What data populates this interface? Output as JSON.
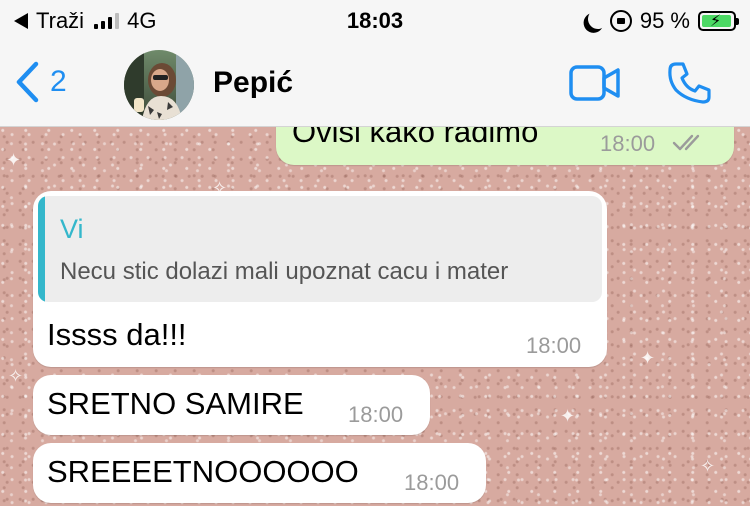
{
  "status_bar": {
    "carrier": "Traži",
    "network": "4G",
    "time": "18:03",
    "battery_percent": "95 %",
    "battery_level": 0.95,
    "icons": [
      "back-triangle-icon",
      "signal-icon",
      "moon-icon",
      "rotation-lock-icon",
      "battery-charging-icon"
    ]
  },
  "header": {
    "back_count": "2",
    "contact_name": "Pepić",
    "icons": [
      "chevron-left-icon",
      "avatar",
      "video-call-icon",
      "phone-icon"
    ]
  },
  "colors": {
    "accent": "#1f8ef1",
    "outgoing_bubble": "#dcf8c6",
    "incoming_bubble": "#ffffff",
    "quote_accent": "#34b7cb",
    "chat_background": "#d7aaa0",
    "battery": "#4cd964"
  },
  "messages": [
    {
      "direction": "out",
      "text": "Ovisi kako radimo",
      "time": "18:00",
      "status": "read"
    },
    {
      "direction": "in",
      "quote_author": "Vi",
      "quote_text": "Necu stic dolazi mali upoznat cacu i mater",
      "text": "Issss da!!!",
      "time": "18:00"
    },
    {
      "direction": "in",
      "text": "SRETNO SAMIRE",
      "time": "18:00"
    },
    {
      "direction": "in",
      "text": "SREEEETNOOOOOO",
      "time": "18:00"
    }
  ]
}
